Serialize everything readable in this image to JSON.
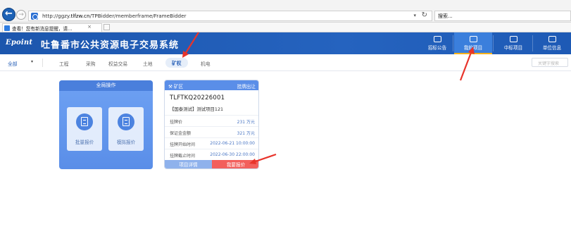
{
  "browser": {
    "back_glyph": "←",
    "forward_glyph": "→",
    "url_prefix": "http://ggzy.",
    "url_domain": "tlfzw.cn",
    "url_path": "/TPBidder/memberframe/FrameBidder",
    "addr_dropdown": "▾",
    "refresh_glyph": "↻",
    "search_placeholder": "搜索...",
    "tab_title": "查看！您有新消息提醒，请...",
    "tab_close": "×"
  },
  "header": {
    "logo": "Epoint",
    "title": "吐鲁番市公共资源电子交易系统",
    "nav": [
      {
        "label": "招标公告",
        "icon": "megaphone-icon",
        "active": false
      },
      {
        "label": "我的项目",
        "icon": "layers-icon",
        "active": true
      },
      {
        "label": "中标项目",
        "icon": "folder-icon",
        "active": false
      },
      {
        "label": "单位信息",
        "icon": "building-icon",
        "active": false
      }
    ],
    "active_underline_color": "#f6b11a",
    "bar_color": "#2563bf"
  },
  "category": {
    "all_label": "全部",
    "caret": "▾",
    "tabs": [
      "工程",
      "采购",
      "权益交易",
      "土地",
      "矿权",
      "机电"
    ],
    "active_tab": "矿权",
    "search_placeholder": "关键字搜索"
  },
  "global_ops": {
    "title": "全局操作",
    "buttons": [
      {
        "label": "批量报价",
        "icon": "batch-quote-icon"
      },
      {
        "label": "模拟报价",
        "icon": "simulate-quote-icon"
      }
    ]
  },
  "project_card": {
    "kind_icon": "mining-pick-icon",
    "kind": "矿区",
    "transfer_type": "挂牌出让",
    "code": "TLFTKQ20226001",
    "name": "【国泰测试】测试项目121",
    "rows": [
      {
        "label": "挂牌价",
        "value": "231 万元"
      },
      {
        "label": "保证金金额",
        "value": "321 万元"
      },
      {
        "label": "挂牌开始时间",
        "value": "2022-06-21 10:00:00"
      },
      {
        "label": "挂牌截止时间",
        "value": "2022-06-30 22:00:00"
      }
    ],
    "detail_button": "项目详情",
    "quote_button": "我要报价",
    "quote_color": "#f25f5c"
  },
  "annotation_color": "#e8342b"
}
